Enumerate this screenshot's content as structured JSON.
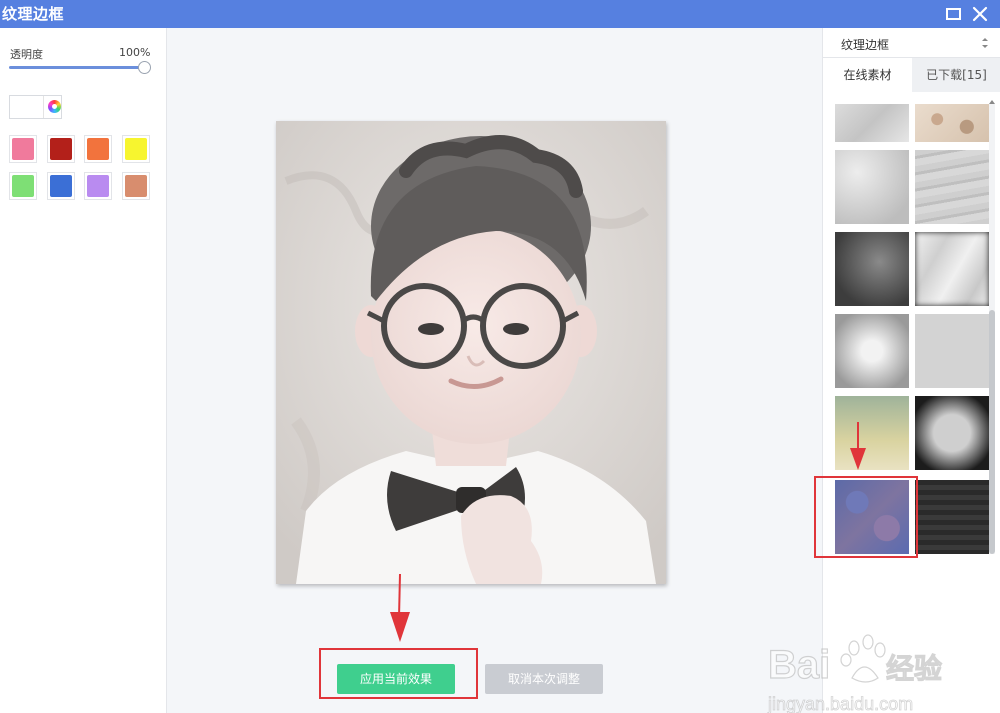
{
  "window": {
    "title": "纹理边框"
  },
  "left_panel": {
    "opacity_label": "透明度",
    "opacity_value": "100%",
    "opacity_percent": 100,
    "preset_colors": [
      "#f07a9c",
      "#b3201a",
      "#f2733d",
      "#f7f52f",
      "#7edf75",
      "#3b6fd6",
      "#b98bf0",
      "#d88d6e"
    ]
  },
  "right_panel": {
    "dropdown_label": "纹理边框",
    "tabs": [
      {
        "label": "在线素材",
        "active": true
      },
      {
        "label": "已下载[15]",
        "active": false
      }
    ]
  },
  "actions": {
    "apply_label": "应用当前效果",
    "cancel_label": "取消本次调整"
  },
  "watermark": {
    "brand": "Bai",
    "brand_cn": "经验",
    "url": "jingyan.baidu.com"
  },
  "colors": {
    "titlebar": "#5680e0",
    "accent_green": "#3fcf8e",
    "highlight_red": "#e0353a"
  }
}
